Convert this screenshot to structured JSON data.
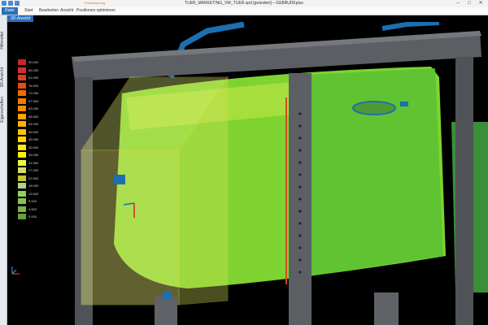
{
  "window": {
    "title": "TUER_MARKETING_VW_TUER.spd [geändert] – GEBÄUDEplus"
  },
  "ribbon": {
    "tabs": [
      {
        "label": "Datei",
        "active": true
      },
      {
        "label": "Start",
        "active": false
      },
      {
        "label": "Bearbeiten",
        "active": false
      },
      {
        "label": "Ansicht",
        "active": false
      },
      {
        "label": "Positionen optimieren",
        "active": false
      }
    ],
    "context_label": "Positionierung"
  },
  "side_tabs": [
    "Hilfsmittel",
    "3D-Ansicht",
    "Eigenschaften"
  ],
  "view": {
    "label": "3D-Ansicht"
  },
  "legend": {
    "entries": [
      {
        "label": "90.000",
        "color": "#c62828"
      },
      {
        "label": "85.000",
        "color": "#d32f2f"
      },
      {
        "label": "81.000",
        "color": "#d84315"
      },
      {
        "label": "76.500",
        "color": "#e64a19"
      },
      {
        "label": "72.000",
        "color": "#ef6c00"
      },
      {
        "label": "67.500",
        "color": "#f57c00"
      },
      {
        "label": "63.000",
        "color": "#fb8c00"
      },
      {
        "label": "58.500",
        "color": "#ffa000"
      },
      {
        "label": "54.000",
        "color": "#ffb300"
      },
      {
        "label": "49.500",
        "color": "#ffc107"
      },
      {
        "label": "45.000",
        "color": "#ffd600"
      },
      {
        "label": "40.500",
        "color": "#ffea00"
      },
      {
        "label": "36.000",
        "color": "#fff200"
      },
      {
        "label": "31.500",
        "color": "#eeff41"
      },
      {
        "label": "27.000",
        "color": "#d4e157"
      },
      {
        "label": "22.500",
        "color": "#c0ca33"
      },
      {
        "label": "18.000",
        "color": "#aed581"
      },
      {
        "label": "13.500",
        "color": "#9ccc65"
      },
      {
        "label": "9.000",
        "color": "#8bc34a"
      },
      {
        "label": "4.500",
        "color": "#7cb342"
      },
      {
        "label": "0.000",
        "color": "#689f38"
      }
    ]
  }
}
